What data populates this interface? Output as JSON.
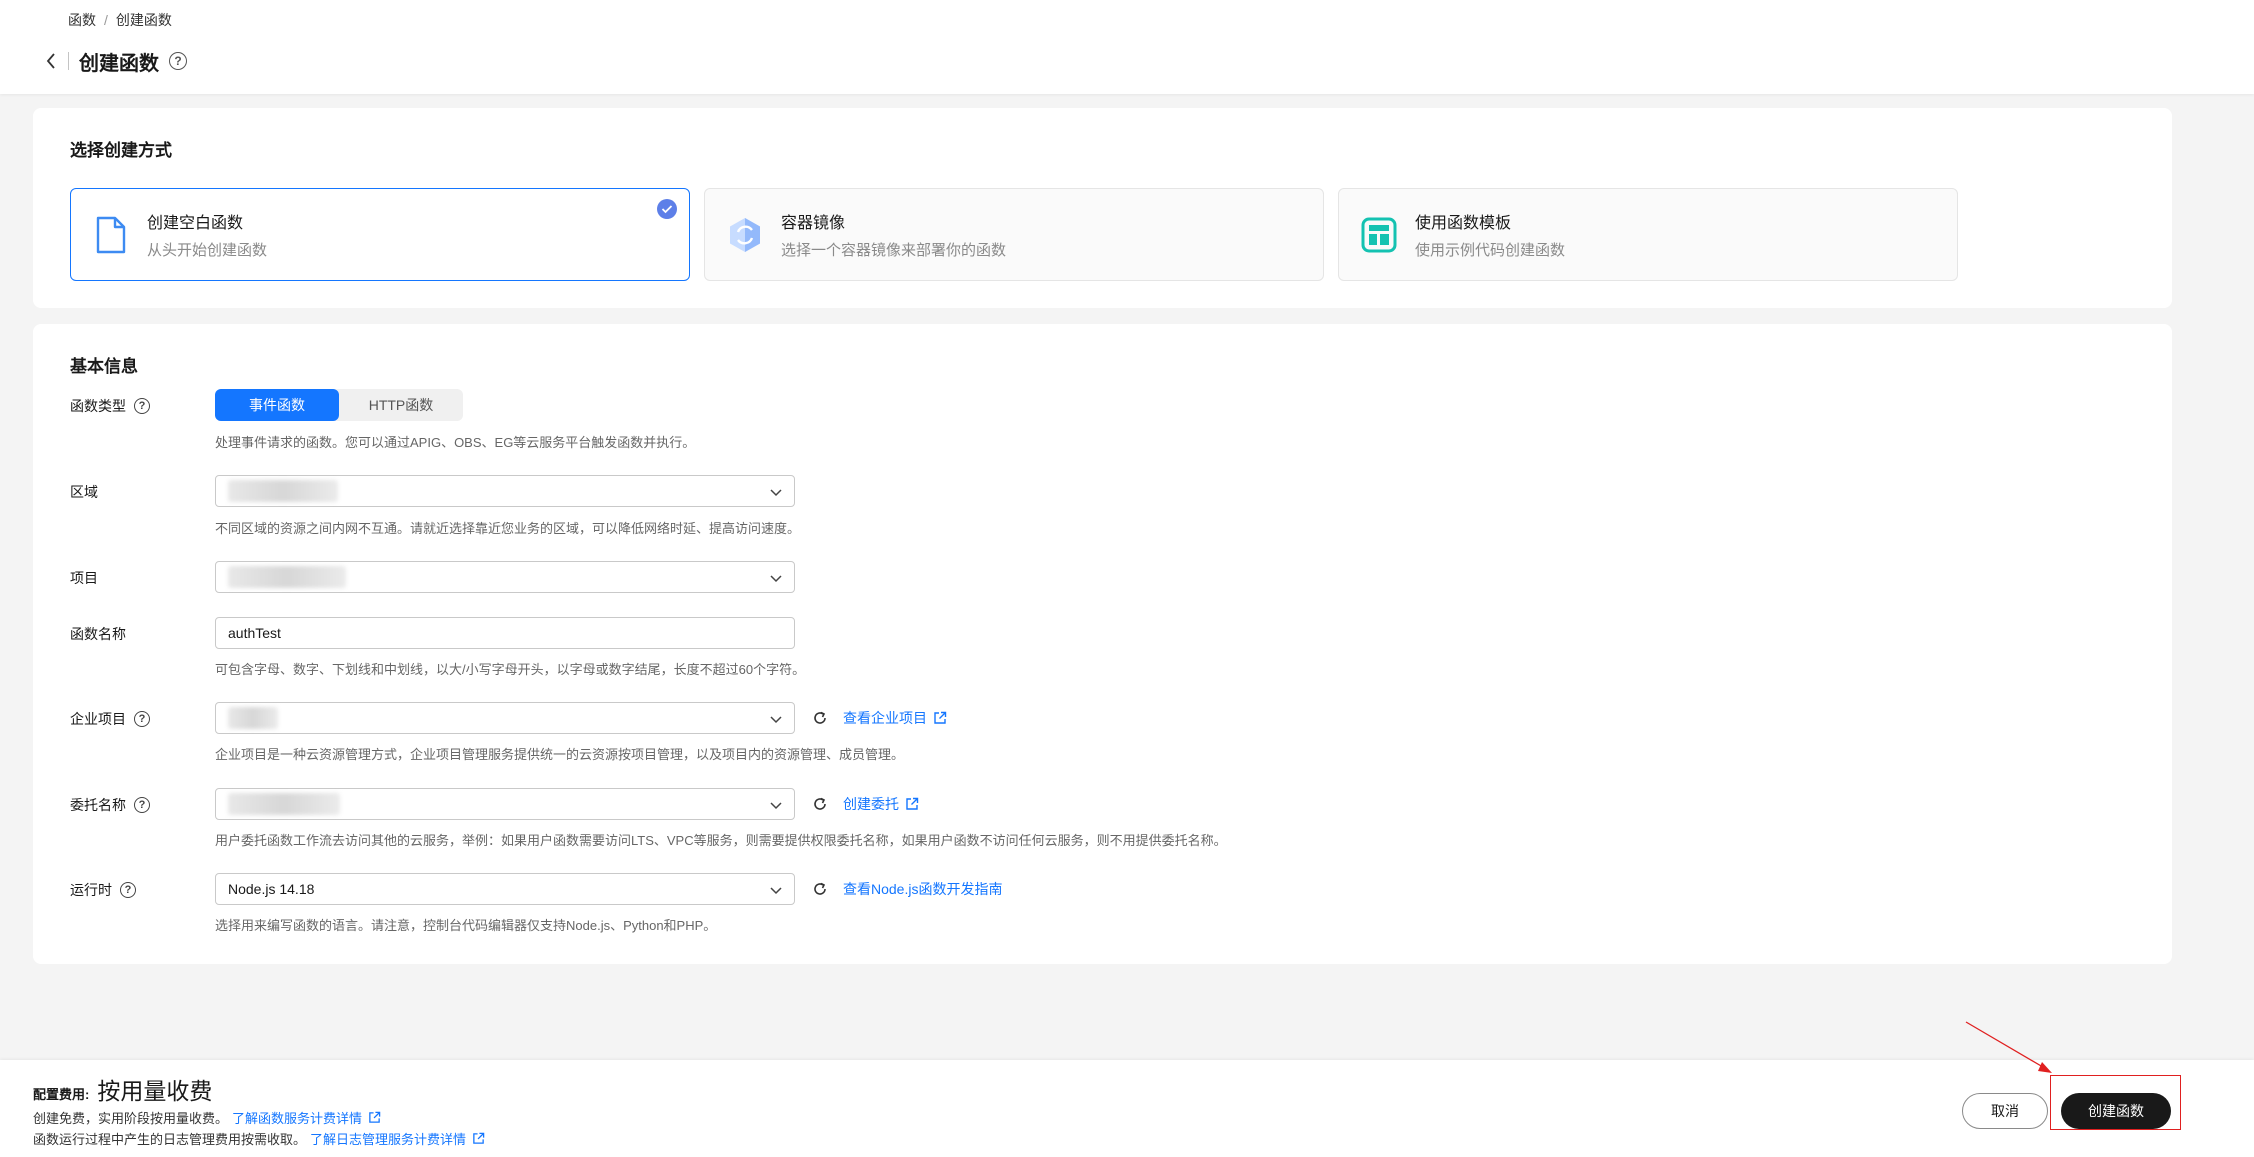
{
  "breadcrumb": {
    "parent": "函数",
    "separator": "/",
    "current": "创建函数"
  },
  "header": {
    "title": "创建函数",
    "help_glyph": "?"
  },
  "method": {
    "section_title": "选择创建方式",
    "options": [
      {
        "name": "创建空白函数",
        "desc": "从头开始创建函数",
        "selected": true,
        "icon": "file-icon"
      },
      {
        "name": "容器镜像",
        "desc": "选择一个容器镜像来部署你的函数",
        "selected": false,
        "icon": "container-icon"
      },
      {
        "name": "使用函数模板",
        "desc": "使用示例代码创建函数",
        "selected": false,
        "icon": "template-icon"
      }
    ]
  },
  "basic": {
    "section_title": "基本信息",
    "function_type": {
      "label": "函数类型",
      "options": [
        "事件函数",
        "HTTP函数"
      ],
      "selected": "事件函数",
      "hint": "处理事件请求的函数。您可以通过APIG、OBS、EG等云服务平台触发函数并执行。"
    },
    "region": {
      "label": "区域",
      "hint": "不同区域的资源之间内网不互通。请就近选择靠近您业务的区域，可以降低网络时延、提高访问速度。"
    },
    "project": {
      "label": "项目"
    },
    "function_name": {
      "label": "函数名称",
      "value": "authTest",
      "hint": "可包含字母、数字、下划线和中划线，以大/小写字母开头，以字母或数字结尾，长度不超过60个字符。"
    },
    "enterprise_project": {
      "label": "企业项目",
      "link": "查看企业项目",
      "hint": "企业项目是一种云资源管理方式，企业项目管理服务提供统一的云资源按项目管理，以及项目内的资源管理、成员管理。"
    },
    "agency": {
      "label": "委托名称",
      "link": "创建委托",
      "hint": "用户委托函数工作流去访问其他的云服务，举例：如果用户函数需要访问LTS、VPC等服务，则需要提供权限委托名称，如果用户函数不访问任何云服务，则不用提供委托名称。"
    },
    "runtime": {
      "label": "运行时",
      "value": "Node.js 14.18",
      "link": "查看Node.js函数开发指南",
      "hint": "选择用来编写函数的语言。请注意，控制台代码编辑器仅支持Node.js、Python和PHP。"
    }
  },
  "footer": {
    "fee_label": "配置费用:",
    "fee_value": "按用量收费",
    "line1_text": "创建免费，实用阶段按用量收费。",
    "line1_link": "了解函数服务计费详情",
    "line2_text": "函数运行过程中产生的日志管理费用按需收取。",
    "line2_link": "了解日志管理服务计费详情",
    "cancel_label": "取消",
    "create_label": "创建函数"
  },
  "colors": {
    "accent": "#1476ff",
    "primary_button": "#191919",
    "annotation": "#e02020"
  }
}
